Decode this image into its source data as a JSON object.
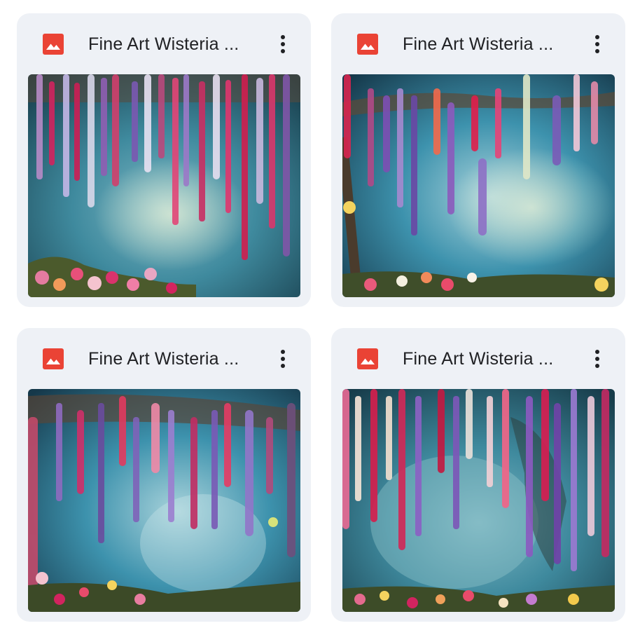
{
  "files": [
    {
      "title": "Fine Art Wisteria ...",
      "icon": "image-file-icon",
      "menu_icon": "more-vert-icon"
    },
    {
      "title": "Fine Art Wisteria ...",
      "icon": "image-file-icon",
      "menu_icon": "more-vert-icon"
    },
    {
      "title": "Fine Art Wisteria ...",
      "icon": "image-file-icon",
      "menu_icon": "more-vert-icon"
    },
    {
      "title": "Fine Art Wisteria ...",
      "icon": "image-file-icon",
      "menu_icon": "more-vert-icon"
    }
  ],
  "colors": {
    "card_background": "#eef1f6",
    "icon_red": "#ea4335",
    "title_text": "#202124",
    "menu_dots": "#202124"
  }
}
